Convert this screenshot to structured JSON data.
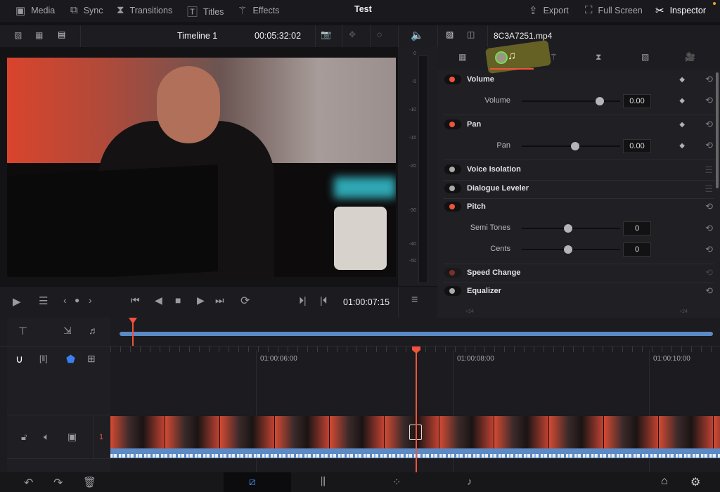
{
  "topbar": {
    "items": [
      {
        "label": "Media",
        "icon": "media-icon"
      },
      {
        "label": "Sync",
        "icon": "sync-icon"
      },
      {
        "label": "Transitions",
        "icon": "transitions-icon"
      },
      {
        "label": "Titles",
        "icon": "titles-icon"
      },
      {
        "label": "Effects",
        "icon": "effects-wand-icon"
      }
    ],
    "project": "Test",
    "export": "Export",
    "fullscreen": "Full Screen",
    "inspector": "Inspector"
  },
  "viewer": {
    "timeline_name": "Timeline 1",
    "duration": "00:05:32:02",
    "timecode": "01:00:07:15"
  },
  "meter": {
    "ticks": [
      "0",
      "-5",
      "-10",
      "-15",
      "-20",
      "-30",
      "-40",
      "-50"
    ]
  },
  "inspector": {
    "clip_name": "8C3A7251.mp4",
    "active_tab": "audio",
    "sections": [
      {
        "label": "Volume",
        "enabled": true,
        "params": [
          {
            "label": "Volume",
            "value": "0.00",
            "slider": 0.75
          }
        ]
      },
      {
        "label": "Pan",
        "enabled": true,
        "params": [
          {
            "label": "Pan",
            "value": "0.00",
            "slider": 0.5
          }
        ]
      },
      {
        "label": "Voice Isolation",
        "enabled": false
      },
      {
        "label": "Dialogue Leveler",
        "enabled": false
      },
      {
        "label": "Pitch",
        "enabled": true,
        "params": [
          {
            "label": "Semi Tones",
            "value": "0",
            "slider": 0.5
          },
          {
            "label": "Cents",
            "value": "0",
            "slider": 0.5
          }
        ]
      },
      {
        "label": "Speed Change",
        "enabled": false
      },
      {
        "label": "Equalizer",
        "enabled": false
      }
    ],
    "eq_scale": "+24"
  },
  "timeline": {
    "ruler": [
      "01:00:06:00",
      "01:00:08:00",
      "01:00:10:00"
    ],
    "track_number": "1",
    "accent": "#f0533a",
    "audio_color": "#5b8ac4"
  }
}
